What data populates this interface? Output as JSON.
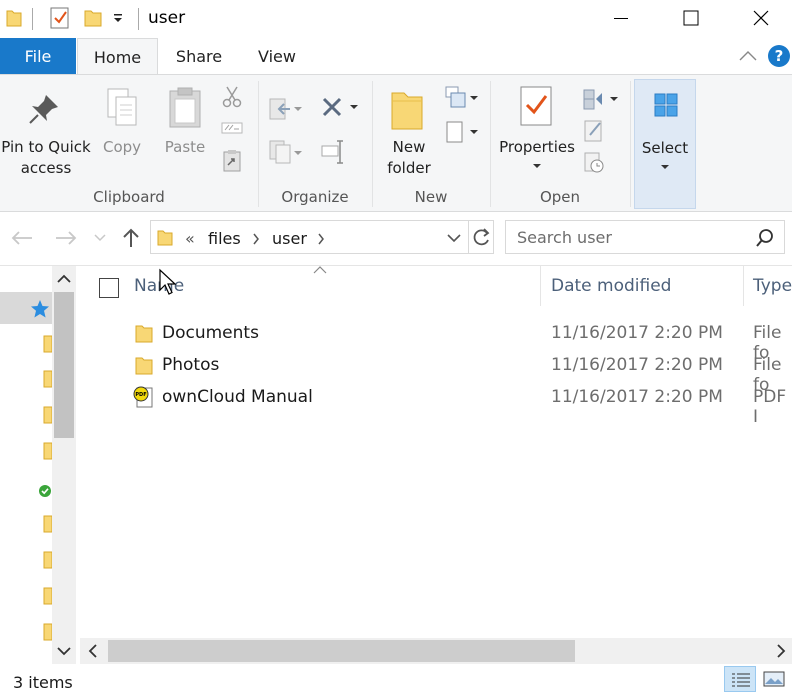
{
  "window": {
    "title": "user",
    "controls": {
      "minimize": "—",
      "maximize": "☐",
      "close": "✕"
    }
  },
  "ribbon": {
    "tabs": [
      {
        "label": "File"
      },
      {
        "label": "Home"
      },
      {
        "label": "Share"
      },
      {
        "label": "View"
      }
    ],
    "groups": {
      "clipboard": {
        "label": "Clipboard",
        "pin_line1": "Pin to Quick",
        "pin_line2": "access",
        "copy": "Copy",
        "paste": "Paste"
      },
      "organize": {
        "label": "Organize"
      },
      "new": {
        "label": "New",
        "folder_line1": "New",
        "folder_line2": "folder"
      },
      "open": {
        "label": "Open",
        "properties": "Properties"
      },
      "select": {
        "label": "Select"
      }
    },
    "help_glyph": "?"
  },
  "address": {
    "overflow_glyph": "«",
    "crumbs": [
      "files",
      "user"
    ],
    "search_placeholder": "Search user"
  },
  "columns": {
    "name": "Name",
    "date": "Date modified",
    "type": "Type"
  },
  "files": [
    {
      "name": "Documents",
      "date": "11/16/2017 2:20 PM",
      "type": "File fo",
      "icon": "folder-icon"
    },
    {
      "name": "Photos",
      "date": "11/16/2017 2:20 PM",
      "type": "File fo",
      "icon": "folder-icon"
    },
    {
      "name": "ownCloud Manual",
      "date": "11/16/2017 2:20 PM",
      "type": "PDF I",
      "icon": "pdf-file-icon"
    }
  ],
  "status": {
    "count": "3 items"
  },
  "colors": {
    "file_tab": "#1979ca",
    "folder": "#f8d775",
    "accent": "#4c607a"
  }
}
